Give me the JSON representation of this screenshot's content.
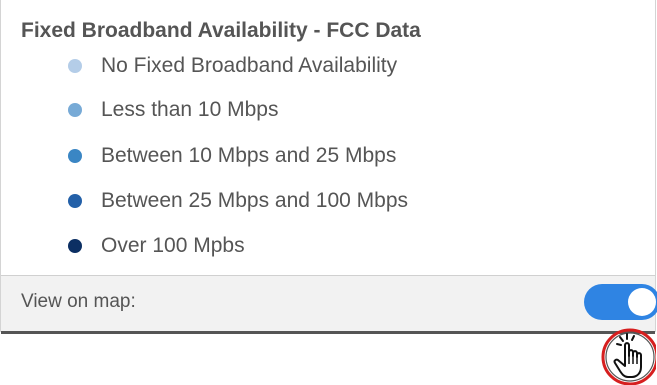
{
  "panel": {
    "title": "Fixed Broadband Availability - FCC Data",
    "legend": [
      {
        "label": "No Fixed Broadband Availability",
        "color": "#b4cde8"
      },
      {
        "label": "Less than 10 Mbps",
        "color": "#77aad6"
      },
      {
        "label": "Between 10 Mbps and 25 Mbps",
        "color": "#3a86c4"
      },
      {
        "label": "Between 25 Mbps and 100 Mbps",
        "color": "#2360a8"
      },
      {
        "label": "Over 100 Mpbs",
        "color": "#0c2f63"
      }
    ],
    "footer": {
      "label": "View on map:",
      "toggle_on": true,
      "toggle_color": "#2f84e3"
    }
  },
  "cursor": {
    "icon": "hand-pointer-click-icon",
    "ring_color": "#d61f1f"
  }
}
